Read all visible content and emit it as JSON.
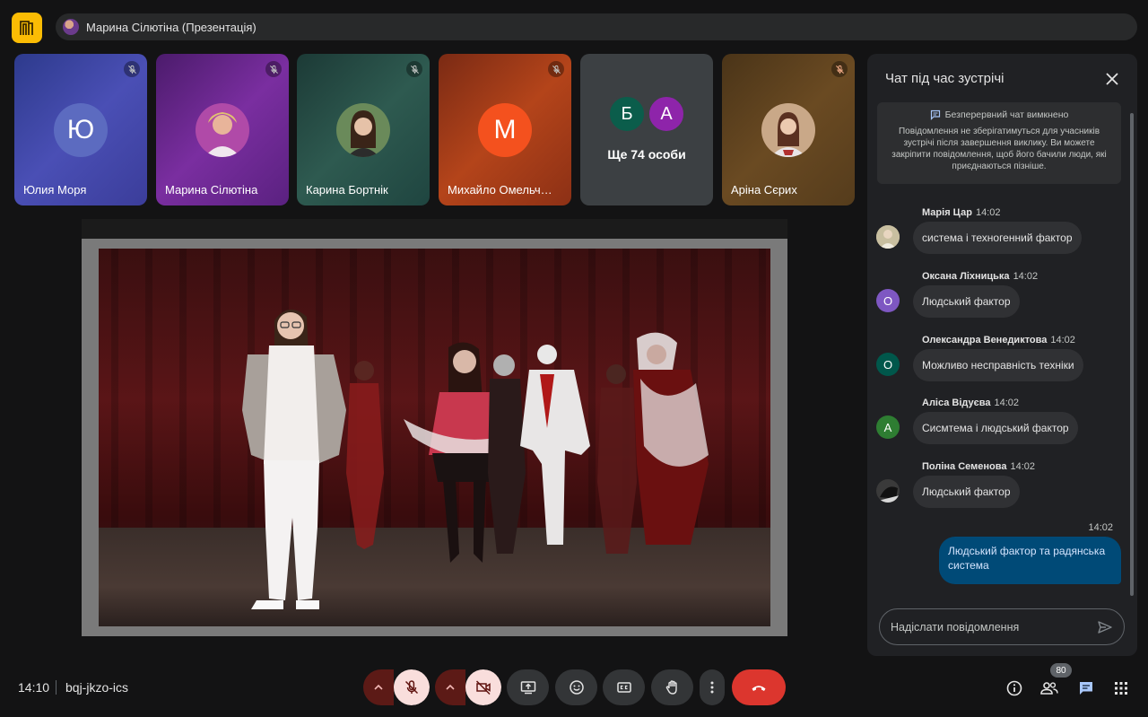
{
  "header": {
    "presenter_label": "Марина Сілютіна (Презентація)"
  },
  "participants": [
    {
      "name": "Юлия Моря",
      "initial": "Ю",
      "avatar_color": "#5c6bc0"
    },
    {
      "name": "Марина Сілютіна",
      "initial": "",
      "avatar_color": "#7a2ea0"
    },
    {
      "name": "Карина Бортнік",
      "initial": "",
      "avatar_color": "#2e5a50"
    },
    {
      "name": "Михайло Омельч…",
      "initial": "М",
      "avatar_color": "#f4511e"
    },
    {
      "name": "Аріна Сєрих",
      "initial": "",
      "avatar_color": "#6a4a22"
    }
  ],
  "overflow_tile": {
    "initials": [
      "Б",
      "А"
    ],
    "colors": [
      "#0b5d4b",
      "#8e24aa"
    ],
    "label": "Ще 74 особи"
  },
  "chat": {
    "title": "Чат під час зустрічі",
    "notice_title": "Безперервний чат вимкнено",
    "notice_body": "Повідомлення не зберігатимуться для учасників зустрічі після завершення виклику. Ви можете закріпити повідомлення, щоб його бачили люди, які приєднаються пізніше.",
    "messages": [
      {
        "author": "Марія Цар",
        "time": "14:02",
        "text": "система і техногенний фактор",
        "initial": "",
        "color": "#a09070"
      },
      {
        "author": "Оксана Ліхницька",
        "time": "14:02",
        "text": "Людський фактор",
        "initial": "О",
        "color": "#7e57c2"
      },
      {
        "author": "Олександра Венедиктова",
        "time": "14:02",
        "text": "Можливо несправність техніки",
        "initial": "О",
        "color": "#00574b"
      },
      {
        "author": "Аліса Відуєва",
        "time": "14:02",
        "text": "Сисмтема і людський фактор",
        "initial": "А",
        "color": "#2e7d32"
      },
      {
        "author": "Поліна Семенова",
        "time": "14:02",
        "text": "Людський фактор",
        "initial": "",
        "color": "#222222"
      }
    ],
    "own_message": {
      "time": "14:02",
      "text": "Людський фактор та радянська система"
    },
    "input_placeholder": "Надіслати повідомлення"
  },
  "footer": {
    "clock": "14:10",
    "meeting_code": "bqj-jkzo-ics",
    "people_count": "80"
  },
  "colors": {
    "accent_hangup": "#dc362e",
    "muted_background": "#f9dedc",
    "own_bubble": "#004a77"
  }
}
